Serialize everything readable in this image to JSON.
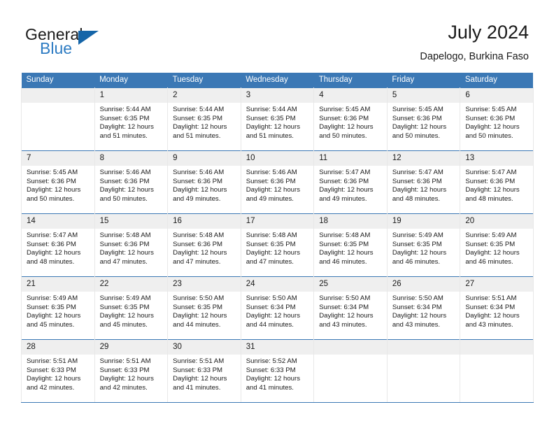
{
  "brand": {
    "word1": "General",
    "word2": "Blue",
    "triangle_color": "#1565a8",
    "blue_color": "#2e7cc3"
  },
  "header": {
    "title": "July 2024",
    "subtitle": "Dapelogo, Burkina Faso"
  },
  "theme": {
    "header_blue": "#3b78b5",
    "daynum_band": "#efefef"
  },
  "calendar": {
    "weekday_headers": [
      "Sunday",
      "Monday",
      "Tuesday",
      "Wednesday",
      "Thursday",
      "Friday",
      "Saturday"
    ],
    "weeks": [
      [
        {
          "day": "",
          "sunrise": "",
          "sunset": "",
          "daylight_line1": "",
          "daylight_line2": ""
        },
        {
          "day": "1",
          "sunrise": "Sunrise: 5:44 AM",
          "sunset": "Sunset: 6:35 PM",
          "daylight_line1": "Daylight: 12 hours",
          "daylight_line2": "and 51 minutes."
        },
        {
          "day": "2",
          "sunrise": "Sunrise: 5:44 AM",
          "sunset": "Sunset: 6:35 PM",
          "daylight_line1": "Daylight: 12 hours",
          "daylight_line2": "and 51 minutes."
        },
        {
          "day": "3",
          "sunrise": "Sunrise: 5:44 AM",
          "sunset": "Sunset: 6:35 PM",
          "daylight_line1": "Daylight: 12 hours",
          "daylight_line2": "and 51 minutes."
        },
        {
          "day": "4",
          "sunrise": "Sunrise: 5:45 AM",
          "sunset": "Sunset: 6:36 PM",
          "daylight_line1": "Daylight: 12 hours",
          "daylight_line2": "and 50 minutes."
        },
        {
          "day": "5",
          "sunrise": "Sunrise: 5:45 AM",
          "sunset": "Sunset: 6:36 PM",
          "daylight_line1": "Daylight: 12 hours",
          "daylight_line2": "and 50 minutes."
        },
        {
          "day": "6",
          "sunrise": "Sunrise: 5:45 AM",
          "sunset": "Sunset: 6:36 PM",
          "daylight_line1": "Daylight: 12 hours",
          "daylight_line2": "and 50 minutes."
        }
      ],
      [
        {
          "day": "7",
          "sunrise": "Sunrise: 5:45 AM",
          "sunset": "Sunset: 6:36 PM",
          "daylight_line1": "Daylight: 12 hours",
          "daylight_line2": "and 50 minutes."
        },
        {
          "day": "8",
          "sunrise": "Sunrise: 5:46 AM",
          "sunset": "Sunset: 6:36 PM",
          "daylight_line1": "Daylight: 12 hours",
          "daylight_line2": "and 50 minutes."
        },
        {
          "day": "9",
          "sunrise": "Sunrise: 5:46 AM",
          "sunset": "Sunset: 6:36 PM",
          "daylight_line1": "Daylight: 12 hours",
          "daylight_line2": "and 49 minutes."
        },
        {
          "day": "10",
          "sunrise": "Sunrise: 5:46 AM",
          "sunset": "Sunset: 6:36 PM",
          "daylight_line1": "Daylight: 12 hours",
          "daylight_line2": "and 49 minutes."
        },
        {
          "day": "11",
          "sunrise": "Sunrise: 5:47 AM",
          "sunset": "Sunset: 6:36 PM",
          "daylight_line1": "Daylight: 12 hours",
          "daylight_line2": "and 49 minutes."
        },
        {
          "day": "12",
          "sunrise": "Sunrise: 5:47 AM",
          "sunset": "Sunset: 6:36 PM",
          "daylight_line1": "Daylight: 12 hours",
          "daylight_line2": "and 48 minutes."
        },
        {
          "day": "13",
          "sunrise": "Sunrise: 5:47 AM",
          "sunset": "Sunset: 6:36 PM",
          "daylight_line1": "Daylight: 12 hours",
          "daylight_line2": "and 48 minutes."
        }
      ],
      [
        {
          "day": "14",
          "sunrise": "Sunrise: 5:47 AM",
          "sunset": "Sunset: 6:36 PM",
          "daylight_line1": "Daylight: 12 hours",
          "daylight_line2": "and 48 minutes."
        },
        {
          "day": "15",
          "sunrise": "Sunrise: 5:48 AM",
          "sunset": "Sunset: 6:36 PM",
          "daylight_line1": "Daylight: 12 hours",
          "daylight_line2": "and 47 minutes."
        },
        {
          "day": "16",
          "sunrise": "Sunrise: 5:48 AM",
          "sunset": "Sunset: 6:36 PM",
          "daylight_line1": "Daylight: 12 hours",
          "daylight_line2": "and 47 minutes."
        },
        {
          "day": "17",
          "sunrise": "Sunrise: 5:48 AM",
          "sunset": "Sunset: 6:35 PM",
          "daylight_line1": "Daylight: 12 hours",
          "daylight_line2": "and 47 minutes."
        },
        {
          "day": "18",
          "sunrise": "Sunrise: 5:48 AM",
          "sunset": "Sunset: 6:35 PM",
          "daylight_line1": "Daylight: 12 hours",
          "daylight_line2": "and 46 minutes."
        },
        {
          "day": "19",
          "sunrise": "Sunrise: 5:49 AM",
          "sunset": "Sunset: 6:35 PM",
          "daylight_line1": "Daylight: 12 hours",
          "daylight_line2": "and 46 minutes."
        },
        {
          "day": "20",
          "sunrise": "Sunrise: 5:49 AM",
          "sunset": "Sunset: 6:35 PM",
          "daylight_line1": "Daylight: 12 hours",
          "daylight_line2": "and 46 minutes."
        }
      ],
      [
        {
          "day": "21",
          "sunrise": "Sunrise: 5:49 AM",
          "sunset": "Sunset: 6:35 PM",
          "daylight_line1": "Daylight: 12 hours",
          "daylight_line2": "and 45 minutes."
        },
        {
          "day": "22",
          "sunrise": "Sunrise: 5:49 AM",
          "sunset": "Sunset: 6:35 PM",
          "daylight_line1": "Daylight: 12 hours",
          "daylight_line2": "and 45 minutes."
        },
        {
          "day": "23",
          "sunrise": "Sunrise: 5:50 AM",
          "sunset": "Sunset: 6:35 PM",
          "daylight_line1": "Daylight: 12 hours",
          "daylight_line2": "and 44 minutes."
        },
        {
          "day": "24",
          "sunrise": "Sunrise: 5:50 AM",
          "sunset": "Sunset: 6:34 PM",
          "daylight_line1": "Daylight: 12 hours",
          "daylight_line2": "and 44 minutes."
        },
        {
          "day": "25",
          "sunrise": "Sunrise: 5:50 AM",
          "sunset": "Sunset: 6:34 PM",
          "daylight_line1": "Daylight: 12 hours",
          "daylight_line2": "and 43 minutes."
        },
        {
          "day": "26",
          "sunrise": "Sunrise: 5:50 AM",
          "sunset": "Sunset: 6:34 PM",
          "daylight_line1": "Daylight: 12 hours",
          "daylight_line2": "and 43 minutes."
        },
        {
          "day": "27",
          "sunrise": "Sunrise: 5:51 AM",
          "sunset": "Sunset: 6:34 PM",
          "daylight_line1": "Daylight: 12 hours",
          "daylight_line2": "and 43 minutes."
        }
      ],
      [
        {
          "day": "28",
          "sunrise": "Sunrise: 5:51 AM",
          "sunset": "Sunset: 6:33 PM",
          "daylight_line1": "Daylight: 12 hours",
          "daylight_line2": "and 42 minutes."
        },
        {
          "day": "29",
          "sunrise": "Sunrise: 5:51 AM",
          "sunset": "Sunset: 6:33 PM",
          "daylight_line1": "Daylight: 12 hours",
          "daylight_line2": "and 42 minutes."
        },
        {
          "day": "30",
          "sunrise": "Sunrise: 5:51 AM",
          "sunset": "Sunset: 6:33 PM",
          "daylight_line1": "Daylight: 12 hours",
          "daylight_line2": "and 41 minutes."
        },
        {
          "day": "31",
          "sunrise": "Sunrise: 5:52 AM",
          "sunset": "Sunset: 6:33 PM",
          "daylight_line1": "Daylight: 12 hours",
          "daylight_line2": "and 41 minutes."
        },
        {
          "day": "",
          "sunrise": "",
          "sunset": "",
          "daylight_line1": "",
          "daylight_line2": ""
        },
        {
          "day": "",
          "sunrise": "",
          "sunset": "",
          "daylight_line1": "",
          "daylight_line2": ""
        },
        {
          "day": "",
          "sunrise": "",
          "sunset": "",
          "daylight_line1": "",
          "daylight_line2": ""
        }
      ]
    ]
  }
}
